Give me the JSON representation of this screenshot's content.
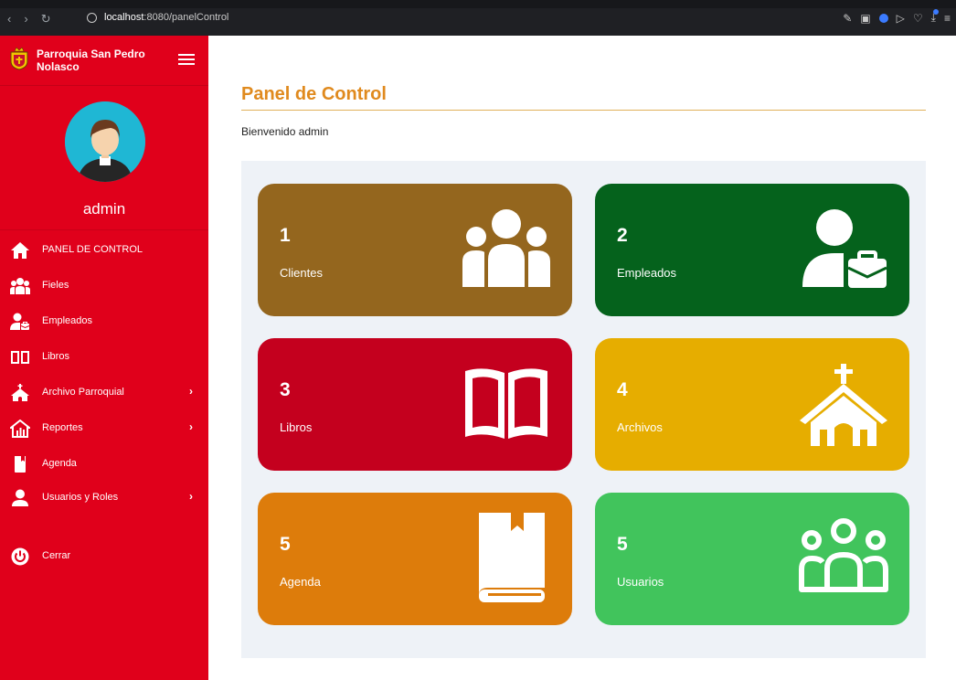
{
  "browser": {
    "url_host": "localhost",
    "url_rest": ":8080/panelControl"
  },
  "sidebar": {
    "brand_line1": "Parroquia San Pedro",
    "brand_line2": "Nolasco",
    "user": "admin",
    "items": [
      {
        "label": "PANEL DE CONTROL",
        "icon": "home-icon"
      },
      {
        "label": "Fieles",
        "icon": "users-icon"
      },
      {
        "label": "Empleados",
        "icon": "user-briefcase-icon"
      },
      {
        "label": "Libros",
        "icon": "book-open-icon"
      },
      {
        "label": "Archivo Parroquial",
        "icon": "church-icon",
        "submenu": true
      },
      {
        "label": "Reportes",
        "icon": "chart-house-icon",
        "submenu": true
      },
      {
        "label": "Agenda",
        "icon": "bookmark-book-icon"
      },
      {
        "label": "Usuarios y Roles",
        "icon": "user-icon",
        "submenu": true
      },
      {
        "label": "Cerrar",
        "icon": "power-icon"
      }
    ]
  },
  "main": {
    "title": "Panel de Control",
    "welcome": "Bienvenido admin",
    "cards": [
      {
        "count": "1",
        "label": "Clientes",
        "color": "#94661e",
        "icon": "users-icon"
      },
      {
        "count": "2",
        "label": "Empleados",
        "color": "#05621c",
        "icon": "user-briefcase-icon"
      },
      {
        "count": "3",
        "label": "Libros",
        "color": "#c4001e",
        "icon": "book-open-icon"
      },
      {
        "count": "4",
        "label": "Archivos",
        "color": "#e6ad00",
        "icon": "church-icon"
      },
      {
        "count": "5",
        "label": "Agenda",
        "color": "#dd7c0b",
        "icon": "bookmark-book-icon"
      },
      {
        "count": "5",
        "label": "Usuarios",
        "color": "#41c45c",
        "icon": "users-outline-icon"
      }
    ]
  },
  "colors": {
    "sidebar": "#e0001b",
    "title": "#e08a1e",
    "panel": "#eef2f7"
  }
}
